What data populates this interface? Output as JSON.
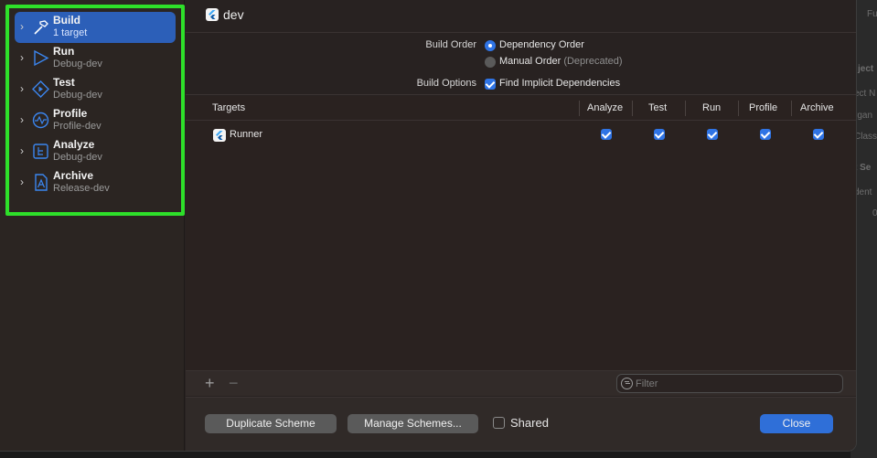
{
  "window": {
    "title": "dev"
  },
  "sidebar": {
    "actions": [
      {
        "name": "Build",
        "sub": "1 target",
        "icon": "hammer-icon",
        "selected": true
      },
      {
        "name": "Run",
        "sub": "Debug-dev",
        "icon": "play-icon"
      },
      {
        "name": "Test",
        "sub": "Debug-dev",
        "icon": "test-diamond-icon"
      },
      {
        "name": "Profile",
        "sub": "Profile-dev",
        "icon": "profile-wave-icon"
      },
      {
        "name": "Analyze",
        "sub": "Debug-dev",
        "icon": "analyze-icon"
      },
      {
        "name": "Archive",
        "sub": "Release-dev",
        "icon": "archive-icon"
      }
    ]
  },
  "options": {
    "build_order_label": "Build Order",
    "dependency_order": "Dependency Order",
    "manual_order": "Manual Order",
    "deprecated": "(Deprecated)",
    "build_options_label": "Build Options",
    "find_implicit": "Find Implicit Dependencies"
  },
  "table": {
    "headers": [
      "Targets",
      "Analyze",
      "Test",
      "Run",
      "Profile",
      "Archive"
    ],
    "rows": [
      {
        "name": "Runner",
        "analyze": true,
        "test": true,
        "run": true,
        "profile": true,
        "archive": true
      }
    ]
  },
  "footer": {
    "add": "+",
    "remove": "−",
    "filter_placeholder": "Filter"
  },
  "buttons": {
    "duplicate": "Duplicate Scheme",
    "manage": "Manage Schemes...",
    "shared": "Shared",
    "close": "Close"
  },
  "background": {
    "snippets": [
      "Fu",
      "ject",
      "ect N",
      "rgan",
      "Class",
      "t Se",
      "dent",
      "0"
    ]
  },
  "colors": {
    "accent": "#2f74e5",
    "selection": "#2c5fb8",
    "highlight_box": "#2ee02a"
  }
}
